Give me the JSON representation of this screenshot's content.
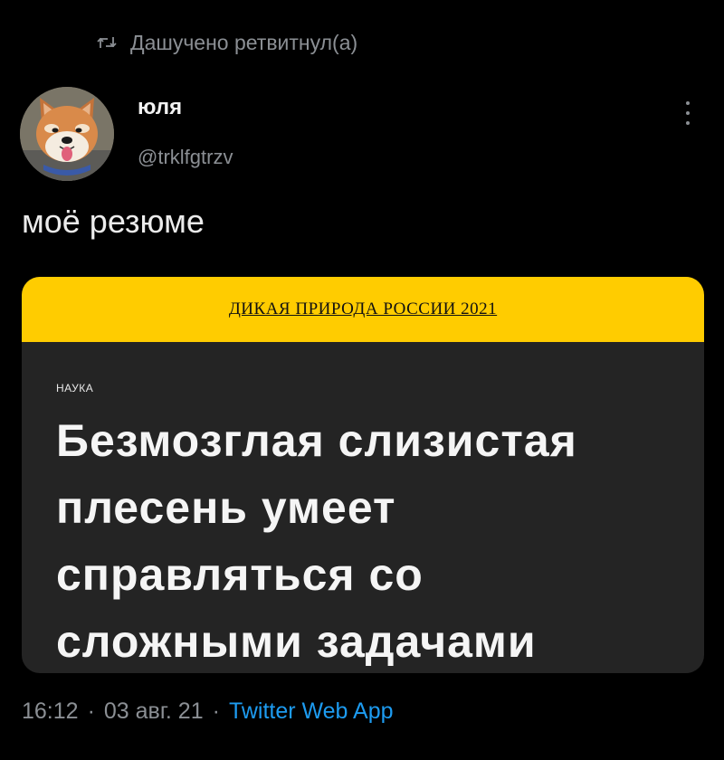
{
  "retweet": {
    "text": "Дашучено ретвитнул(а)",
    "icon": "retweet-icon"
  },
  "author": {
    "name": "юля",
    "handle": "@trklfgtrzv",
    "avatar": "shiba-dog-avatar"
  },
  "tweet": {
    "text": "моё резюме"
  },
  "card": {
    "banner": "ДИКАЯ ПРИРОДА РОССИИ 2021",
    "category": "НАУКА",
    "title": "Безмозглая слизистая плесень умеет справляться со сложными задачами",
    "banner_color": "#ffcc00",
    "background_color": "#242424"
  },
  "meta": {
    "time": "16:12",
    "separator": "·",
    "date": "03 авг. 21",
    "source": "Twitter Web App"
  },
  "colors": {
    "background": "#000000",
    "muted_text": "#8b8f94",
    "link": "#1d9bf0"
  }
}
